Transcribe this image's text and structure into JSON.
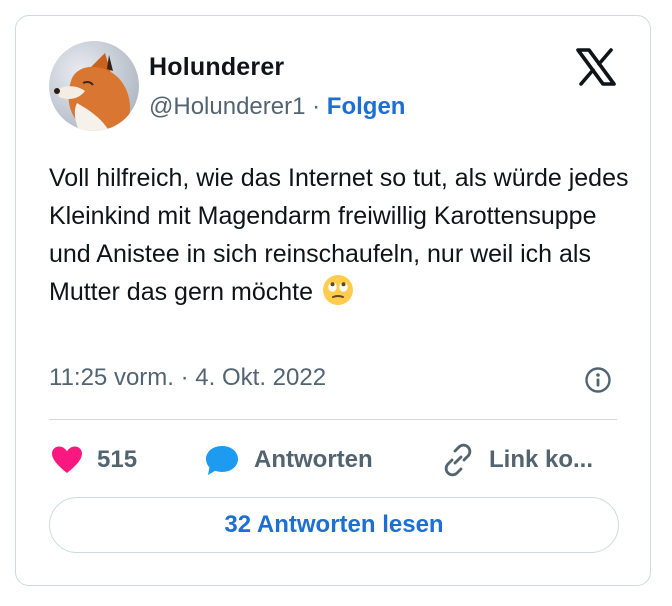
{
  "author": {
    "display_name": "Holunderer",
    "handle": "@Holunderer1",
    "separator": "·",
    "follow_label": "Folgen"
  },
  "tweet": {
    "text": "Voll hilfreich, wie das Internet so tut, als würde jedes Kleinkind mit Magendarm freiwillig Karottensuppe und Anistee in sich reinschaufeln, nur weil ich als Mutter das gern möchte",
    "emoji": "face-with-rolling-eyes",
    "time": "11:25 vorm.",
    "date_separator": "·",
    "date": "4. Okt. 2022"
  },
  "actions": {
    "likes_count": "515",
    "reply_label": "Antworten",
    "copy_link_label": "Link ko..."
  },
  "read_replies_label": "32 Antworten lesen",
  "colors": {
    "link_blue": "#1d6fd1",
    "like_pink": "#f91880",
    "reply_blue": "#1d9bf0",
    "muted_gray": "#536471",
    "border": "#cfd9de"
  }
}
